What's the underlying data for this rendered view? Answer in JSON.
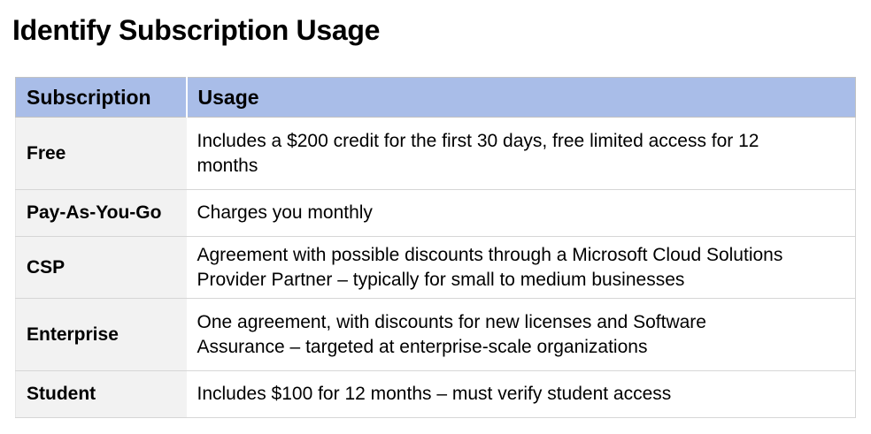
{
  "page": {
    "title": "Identify Subscription Usage"
  },
  "table": {
    "headers": [
      "Subscription",
      "Usage"
    ],
    "rows": [
      {
        "name": "Free",
        "usage": "Includes a $200 credit for the first 30 days, free limited access for 12 months"
      },
      {
        "name": "Pay-As-You-Go",
        "usage": "Charges you monthly"
      },
      {
        "name": "CSP",
        "usage": "Agreement with possible discounts through a Microsoft Cloud Solutions Provider Partner – typically for small to medium businesses"
      },
      {
        "name": "Enterprise",
        "usage": "One agreement, with discounts for new licenses and Software Assurance – targeted at enterprise-scale organizations"
      },
      {
        "name": "Student",
        "usage": "Includes $100 for 12 months – must verify student access"
      }
    ]
  },
  "colors": {
    "header_bg": "#a9bde8",
    "name_cell_bg": "#f2f2f2",
    "usage_cell_bg": "#ffffff"
  }
}
